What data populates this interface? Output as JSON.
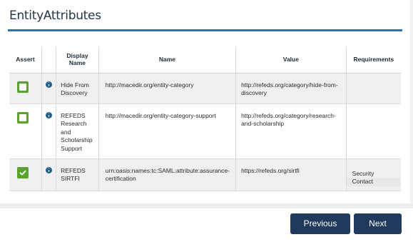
{
  "page": {
    "title": "EntityAttributes"
  },
  "table": {
    "headers": {
      "assert": "Assert",
      "display_name_line1": "Display",
      "display_name_line2": "Name",
      "name": "Name",
      "value": "Value",
      "requirements": "Requirements"
    },
    "rows": [
      {
        "assert_checked": false,
        "display_name": "Hide From Discovery",
        "name": "http://macedir.org/entity-category",
        "value": "http://refeds.org/category/hide-from-discovery",
        "requirements": ""
      },
      {
        "assert_checked": false,
        "display_name": "REFEDS Research and Scholarship Support",
        "name": "http://macedir.org/entity-category-support",
        "value": "http://refeds.org/category/research-and-scholarship",
        "requirements": ""
      },
      {
        "assert_checked": true,
        "display_name": "REFEDS SIRTFI",
        "name": "urn:oasis:names:tc:SAML:attribute:assurance-certification",
        "value": "https://refeds.org/sirtfi",
        "requirements_line1": "Security",
        "requirements_line2": "Contact"
      }
    ]
  },
  "buttons": {
    "previous": "Previous",
    "next": "Next"
  },
  "colors": {
    "accent": "#2f74a8",
    "checkbox_green": "#58a52e",
    "button_navy": "#1f3a5c",
    "info_icon": "#1f5f93"
  },
  "icons": {
    "info": "info-circle-icon",
    "check": "checkmark-icon"
  }
}
